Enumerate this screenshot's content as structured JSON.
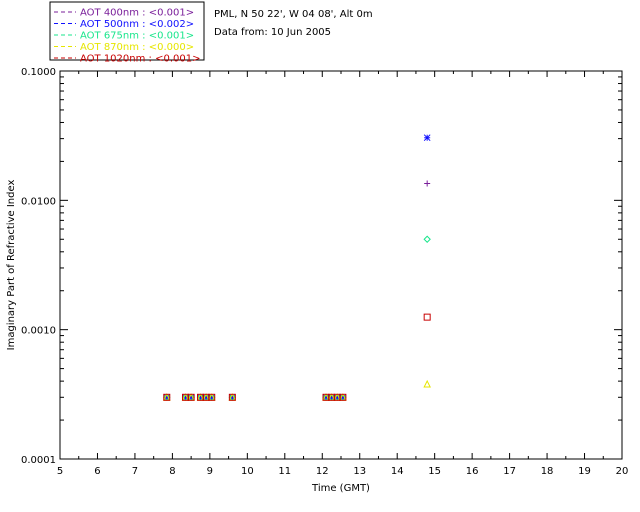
{
  "chart_data": {
    "type": "scatter",
    "header": {
      "site": "PML, N 50 22', W 04 08', Alt 0m",
      "date": "Data from: 10 Jun 2005"
    },
    "xlabel": "Time (GMT)",
    "ylabel": "Imaginary Part of Refractive Index",
    "xlim": [
      5,
      20
    ],
    "ylim": [
      0.0001,
      0.1
    ],
    "yscale": "log",
    "x_ticks": [
      "5",
      "6",
      "7",
      "8",
      "9",
      "10",
      "11",
      "12",
      "13",
      "14",
      "15",
      "16",
      "17",
      "18",
      "19",
      "20"
    ],
    "y_ticks": [
      "0.0001",
      "0.0010",
      "0.0100",
      "0.1000"
    ],
    "y_tick_values": [
      0.0001,
      0.001,
      0.01,
      0.1
    ],
    "legend_placement": "top-left, above plot",
    "series": [
      {
        "name": "AOT  400nm : <0.001>",
        "color": "#7a1f9a",
        "marker": "plus",
        "x": [
          7.85,
          8.35,
          8.5,
          8.75,
          8.9,
          9.05,
          9.6,
          12.1,
          12.25,
          12.4,
          12.55,
          14.8
        ],
        "y": [
          0.0003,
          0.0003,
          0.0003,
          0.0003,
          0.0003,
          0.0003,
          0.0003,
          0.0003,
          0.0003,
          0.0003,
          0.0003,
          0.0135
        ]
      },
      {
        "name": "AOT  500nm : <0.002>",
        "color": "#1010ff",
        "marker": "asterisk",
        "x": [
          7.85,
          8.35,
          8.5,
          8.75,
          8.9,
          9.05,
          9.6,
          12.1,
          12.25,
          12.4,
          12.55,
          14.8
        ],
        "y": [
          0.0003,
          0.0003,
          0.0003,
          0.0003,
          0.0003,
          0.0003,
          0.0003,
          0.0003,
          0.0003,
          0.0003,
          0.0003,
          0.0305
        ]
      },
      {
        "name": "AOT  675nm : <0.001>",
        "color": "#19e68c",
        "marker": "diamond",
        "x": [
          7.85,
          8.35,
          8.5,
          8.75,
          8.9,
          9.05,
          9.6,
          12.1,
          12.25,
          12.4,
          12.55,
          14.8
        ],
        "y": [
          0.0003,
          0.0003,
          0.0003,
          0.0003,
          0.0003,
          0.0003,
          0.0003,
          0.0003,
          0.0003,
          0.0003,
          0.0003,
          0.005
        ]
      },
      {
        "name": "AOT  870nm : <0.000>",
        "color": "#e6e600",
        "marker": "triangle",
        "x": [
          7.85,
          8.35,
          8.5,
          8.75,
          8.9,
          9.05,
          9.6,
          12.1,
          12.25,
          12.4,
          12.55,
          14.8
        ],
        "y": [
          0.0003,
          0.0003,
          0.0003,
          0.0003,
          0.0003,
          0.0003,
          0.0003,
          0.0003,
          0.0003,
          0.0003,
          0.0003,
          0.00038
        ]
      },
      {
        "name": "AOT 1020nm : <0.001>",
        "color": "#c80000",
        "marker": "square",
        "x": [
          7.85,
          8.35,
          8.5,
          8.75,
          8.9,
          9.05,
          9.6,
          12.1,
          12.25,
          12.4,
          12.55,
          14.8
        ],
        "y": [
          0.0003,
          0.0003,
          0.0003,
          0.0003,
          0.0003,
          0.0003,
          0.0003,
          0.0003,
          0.0003,
          0.0003,
          0.0003,
          0.00125
        ]
      }
    ]
  }
}
